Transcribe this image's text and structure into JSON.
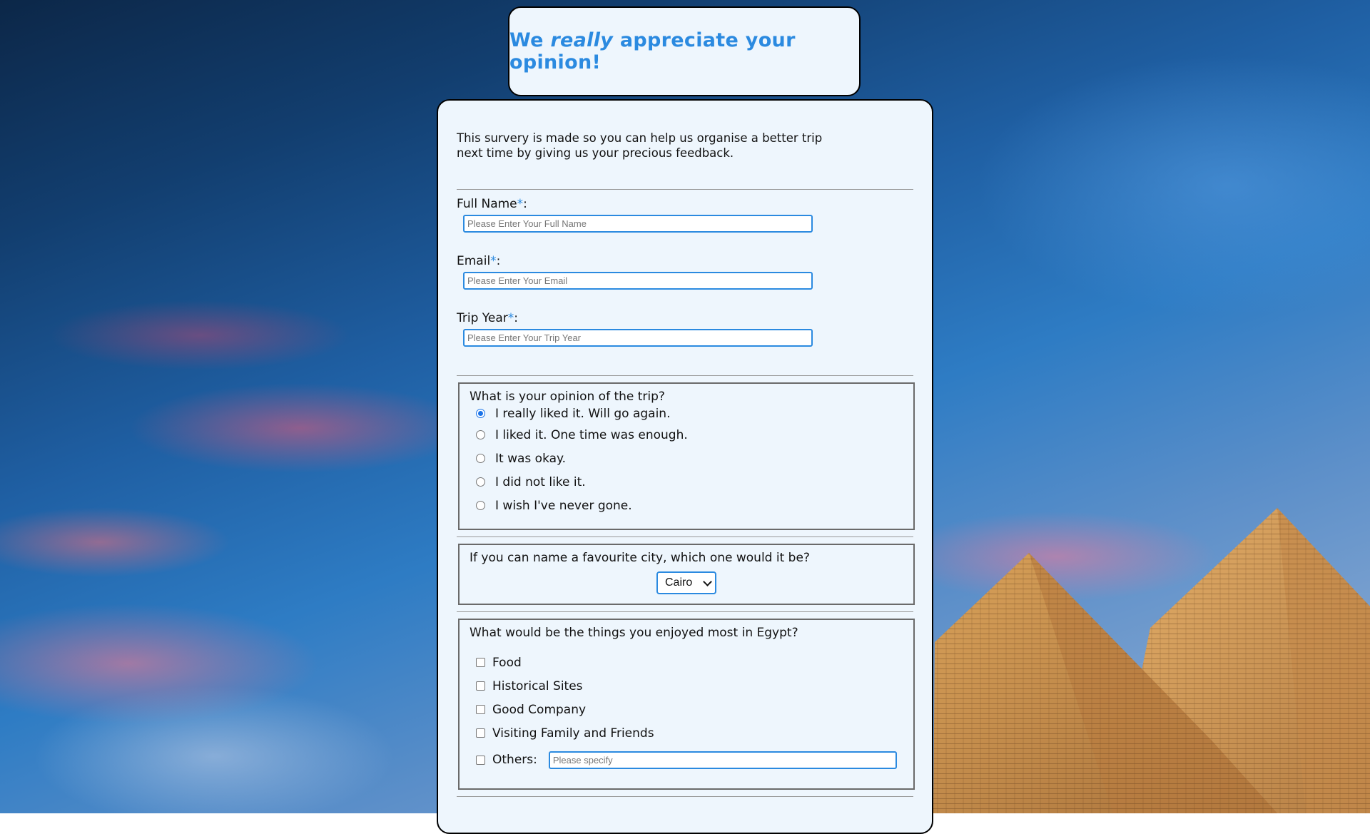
{
  "header": {
    "title_before": "We ",
    "title_emphasis": "really",
    "title_after": " appreciate your opinion!"
  },
  "intro": "This survery is made so you can help us organise a better trip next time by giving us your precious feedback.",
  "fields": {
    "full_name": {
      "label": "Full Name",
      "required_mark": "*",
      "suffix": ":",
      "placeholder": "Please Enter Your Full Name"
    },
    "email": {
      "label": "Email",
      "required_mark": "*",
      "suffix": ":",
      "placeholder": "Please Enter Your Email"
    },
    "trip_year": {
      "label": "Trip Year",
      "required_mark": "*",
      "suffix": ":",
      "placeholder": "Please Enter Your Trip Year"
    }
  },
  "opinion": {
    "question": "What is your opinion of the trip?",
    "options": [
      {
        "label": "I really liked it. Will go again.",
        "checked": true
      },
      {
        "label": "I liked it. One time was enough.",
        "checked": false
      },
      {
        "label": "It was okay.",
        "checked": false
      },
      {
        "label": "I did not like it.",
        "checked": false
      },
      {
        "label": "I wish I've never gone.",
        "checked": false
      }
    ]
  },
  "city": {
    "question": "If you can name a favourite city, which one would it be?",
    "selected": "Cairo"
  },
  "enjoyed": {
    "question": "What would be the things you enjoyed most in Egypt?",
    "options": [
      {
        "label": "Food",
        "checked": false
      },
      {
        "label": "Historical Sites",
        "checked": false
      },
      {
        "label": "Good Company",
        "checked": false
      },
      {
        "label": "Visiting Family and Friends",
        "checked": false
      },
      {
        "label": "Others:",
        "checked": false
      }
    ],
    "others_placeholder": "Please specify"
  },
  "colors": {
    "accent": "#2b8ae0",
    "card_bg": "#eef6fd",
    "radio_checked": "#1a73e8"
  }
}
